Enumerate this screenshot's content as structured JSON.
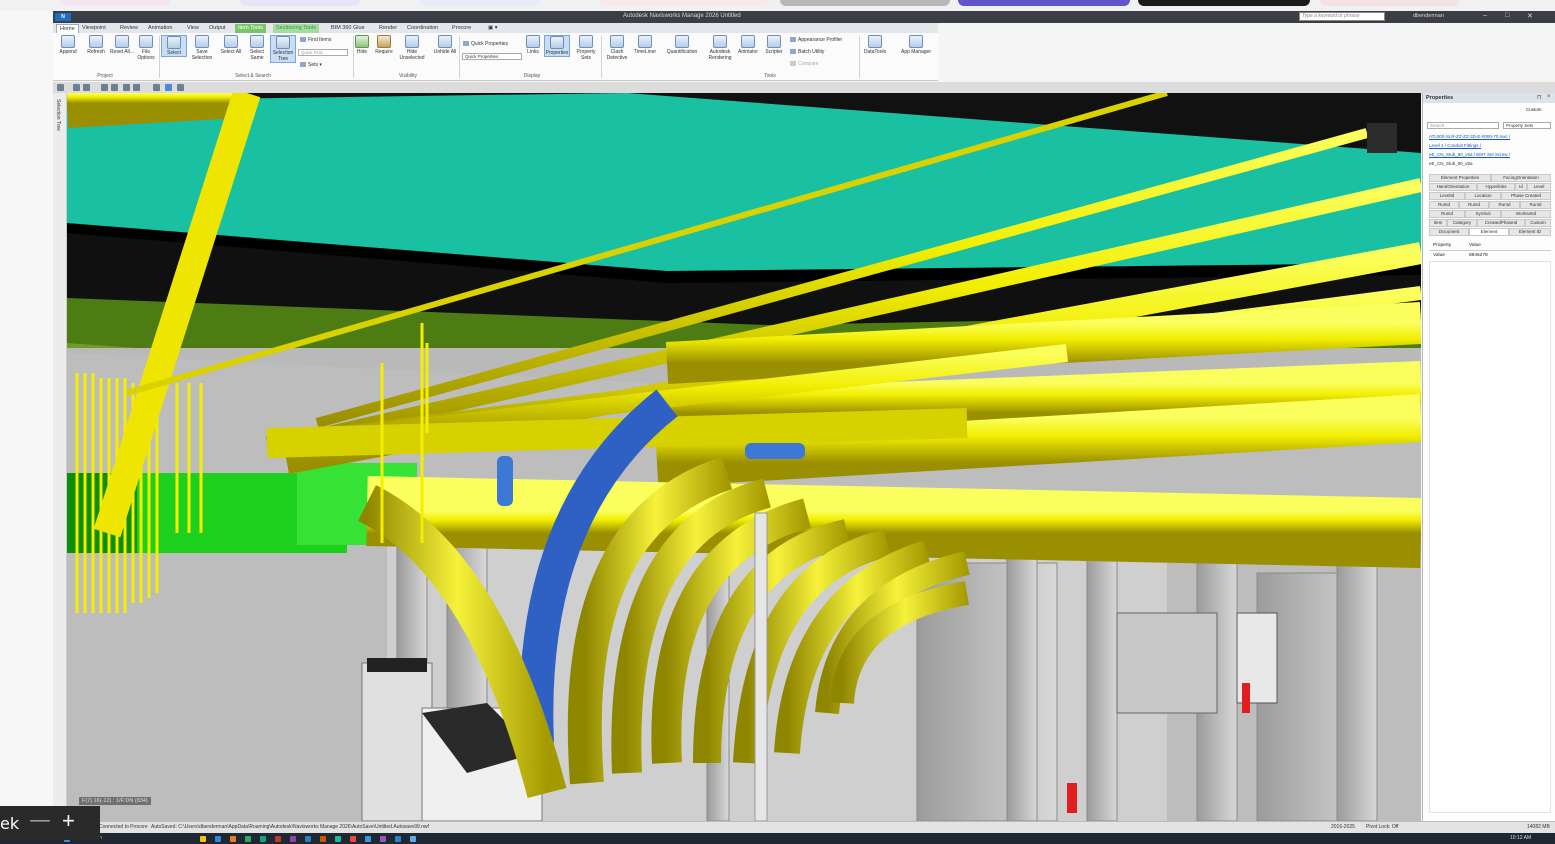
{
  "app": {
    "title": "Autodesk Navisworks Manage 2026    Untitled",
    "logo": "N",
    "search_placeholder": "Type a keyword or phrase",
    "user": "dbenderman"
  },
  "tabs": [
    {
      "label": "Home",
      "state": "active"
    },
    {
      "label": "Viewpoint"
    },
    {
      "label": "Review"
    },
    {
      "label": "Animation"
    },
    {
      "label": "View"
    },
    {
      "label": "Output"
    },
    {
      "label": "Item Tools",
      "state": "contextual"
    },
    {
      "label": "Sectioning Tools",
      "state": "contextual2"
    },
    {
      "label": "BIM 360 Glue"
    },
    {
      "label": "Render"
    },
    {
      "label": "Coordination"
    },
    {
      "label": "Procore"
    }
  ],
  "ribbon": {
    "buttons": [
      "Append",
      "Refresh",
      "Reset All...",
      "File Options",
      "Select",
      "Save Selection",
      "Select All",
      "Select Same",
      "Selection Tree",
      "Hide",
      "Require",
      "Hide Unselected",
      "Unhide All",
      "Links",
      "Properties",
      "Property Sets",
      "Clash Detective",
      "TimeLiner",
      "Quantification",
      "Autodesk Rendering",
      "Animator",
      "Scripter",
      "DataTools",
      "App Manager"
    ],
    "find_items": "Find Items",
    "quick_find": "Quick Find",
    "sets": "Sets",
    "quick_properties": "Quick Properties",
    "quick_properties_drop": "Quick Properties",
    "appearance_profiler": "Appearance Profiler",
    "batch_utility": "Batch Utility",
    "compare": "Compare",
    "groups": [
      "Project",
      "Select & Search",
      "Visibility",
      "Display",
      "Tools"
    ]
  },
  "selection_tree_label": "Selection Tree",
  "viewport": {
    "level_label": "F(7) 16(-12) : 1/F:DN (834)"
  },
  "properties": {
    "title": "Properties",
    "custom": "Custom",
    "search_placeholder": "Search",
    "property_sets": "Property Sets",
    "breadcrumb": [
      "ATL000-SLR-ZZ-ZZ-3D-E-0000-70.nwc /",
      "Level 1 / Conduit Fittings /",
      "eE_CN_Stub_90_v5a / EMT Set Screw /",
      "eE_CN_Stub_90_v5a"
    ],
    "tabs": [
      "Element Properties",
      "FacingOrientation",
      "HandOrientation",
      "Hyperlinks",
      "Id",
      "Level",
      "LevelId",
      "Location",
      "Phase Created",
      "RunId",
      "RunId",
      "RunId",
      "RunId",
      "RunId",
      "Symbol",
      "WorksetId",
      "Item",
      "Category",
      "CreatedPhaseId",
      "Custom",
      "Document",
      "Element",
      "Element ID"
    ],
    "columns": [
      "Property",
      "Value"
    ],
    "rows": [
      [
        "Value",
        "8946278"
      ]
    ]
  },
  "status": {
    "left": "Connected to Procore",
    "autosave": "AutoSaved: C:\\Users\\dbenderman\\AppData\\Roaming\\Autodesk\\Navisworks Manage 2026\\AutoSave\\Untitled.Autosave99.nwf",
    "page": "2016-2025",
    "pivot": "Pivot Lock: Off",
    "memory": "14082 MB"
  },
  "overlay": {
    "text": "ek"
  },
  "taskbar": {
    "search": "Search",
    "time": "10:12 AM"
  }
}
